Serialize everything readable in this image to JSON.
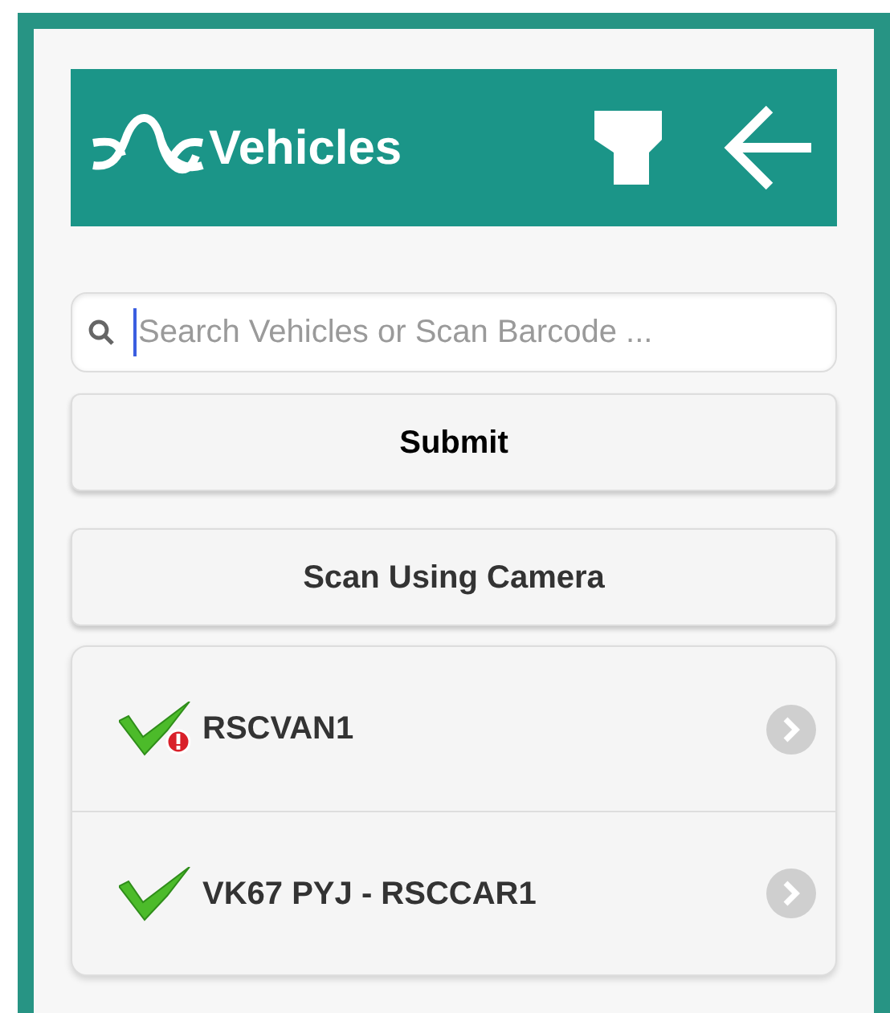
{
  "header": {
    "title": "Vehicles"
  },
  "search": {
    "placeholder": "Search Vehicles or Scan Barcode ..."
  },
  "buttons": [
    {
      "label": "Submit"
    },
    {
      "label": "Scan Using Camera"
    }
  ],
  "vehicles": [
    {
      "label": "RSCVAN1",
      "warning": true
    },
    {
      "label": "VK67 PYJ - RSCCAR1",
      "warning": false
    }
  ]
}
